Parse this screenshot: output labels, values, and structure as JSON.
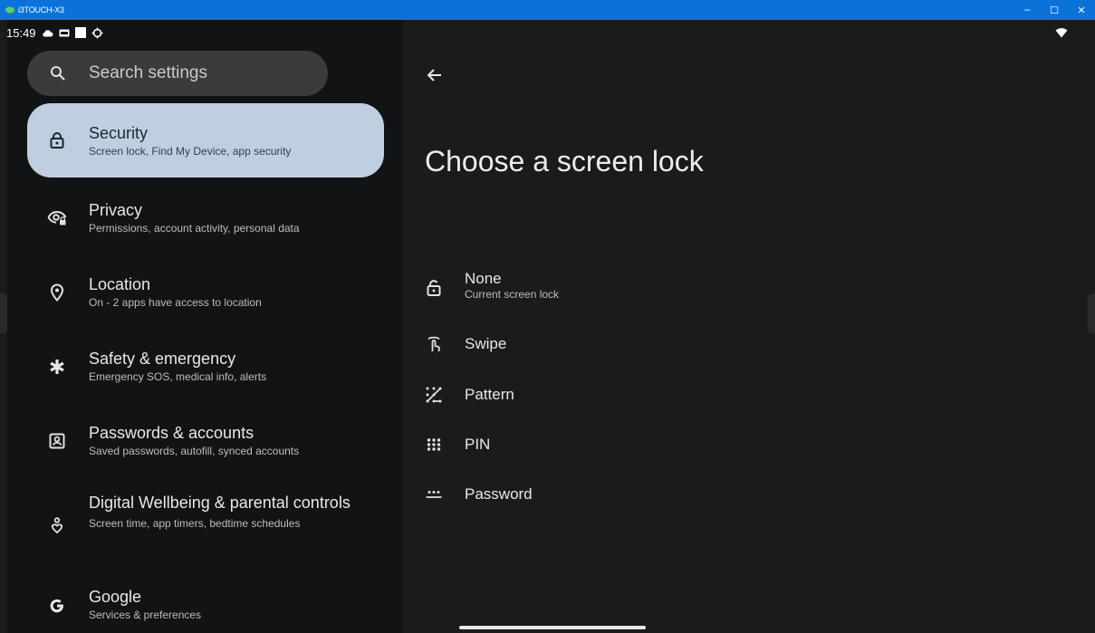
{
  "window": {
    "title": "i3TOUCH-X3",
    "controls": {
      "minimize": "–",
      "maximize": "☐",
      "close": "✕"
    }
  },
  "status_bar": {
    "time": "15:49"
  },
  "search": {
    "placeholder": "Search settings"
  },
  "sidebar": {
    "items": [
      {
        "label": "Security",
        "sub": "Screen lock, Find My Device, app security",
        "icon": "lock-icon",
        "selected": true
      },
      {
        "label": "Privacy",
        "sub": "Permissions, account activity, personal data",
        "icon": "privacy-eye-icon"
      },
      {
        "label": "Location",
        "sub": "On - 2 apps have access to location",
        "icon": "location-pin-icon"
      },
      {
        "label": "Safety & emergency",
        "sub": "Emergency SOS, medical info, alerts",
        "icon": "asterisk-icon"
      },
      {
        "label": "Passwords & accounts",
        "sub": "Saved passwords, autofill, synced accounts",
        "icon": "account-box-icon"
      },
      {
        "label": "Digital Wellbeing & parental controls",
        "sub": "Screen time, app timers, bedtime schedules",
        "icon": "wellbeing-icon"
      },
      {
        "label": "Google",
        "sub": "Services & preferences",
        "icon": "google-g-icon"
      }
    ]
  },
  "main": {
    "title": "Choose a screen lock",
    "options": [
      {
        "label": "None",
        "sub": "Current screen lock",
        "icon": "unlocked-icon"
      },
      {
        "label": "Swipe",
        "icon": "swipe-icon"
      },
      {
        "label": "Pattern",
        "icon": "pattern-icon"
      },
      {
        "label": "PIN",
        "icon": "pin-dots-icon"
      },
      {
        "label": "Password",
        "icon": "password-icon"
      }
    ]
  },
  "colors": {
    "titlebar": "#0b72d8",
    "sidebar_bg": "#111314",
    "main_bg": "#1b1b1b",
    "selected_bg": "#bfcfe0",
    "search_bg": "#3a3b3c"
  }
}
